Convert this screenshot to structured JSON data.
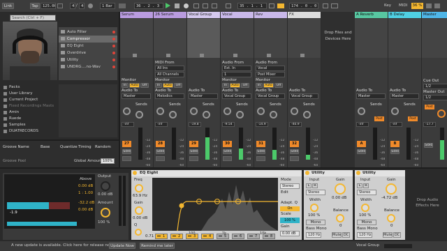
{
  "transport": {
    "link": "Link",
    "tap": "Tap",
    "tempo": "125.00",
    "sig_num": "4",
    "sig_den": "4",
    "quantize": "1 Bar",
    "position": "36 .    2 .    3",
    "loop_start": "35 .    1 .    1",
    "loop_length": "174 .    0 .    0",
    "key_label": "Key",
    "midi_label": "MIDI",
    "cpu": "36 %"
  },
  "browser": {
    "search_placeholder": "Search (Ctrl + F)",
    "categories": [
      "Packs",
      "User Library",
      "Current Project",
      "Fixed Recordings Masts",
      "Amin",
      "Ruede",
      "Samples",
      "DUATRECORDS"
    ],
    "items": [
      {
        "label": "Auto Filter",
        "selected": false
      },
      {
        "label": "Compressor",
        "selected": true
      },
      {
        "label": "EQ Eight",
        "selected": false
      },
      {
        "label": "Overdrive",
        "selected": false
      },
      {
        "label": "Utility",
        "selected": false
      },
      {
        "label": "UNDRG....no-Wav",
        "selected": false
      }
    ]
  },
  "groove": {
    "headers": [
      "Groove Name",
      "Base",
      "Quantize",
      "Timing",
      "Random"
    ],
    "pool_label": "Groove Pool",
    "global_amount_label": "Global Amount",
    "global_amount": "100%"
  },
  "tracks": [
    {
      "name": "Serum",
      "color": "#b99be0",
      "number": "27",
      "vol": "-inf",
      "input_type": "",
      "input_channel": "",
      "monitor": "Off",
      "out": "Master",
      "highlighted": false
    },
    {
      "name": "26 Serum",
      "color": "#b99be0",
      "number": "28",
      "vol": "-inf",
      "input_type": "All Ins",
      "input_channel": "All Channels",
      "monitor": "Off",
      "out": "Melodics",
      "highlighted": false
    },
    {
      "name": "Vocal Group",
      "color": "#d4c8ee",
      "number": "29",
      "vol": "-19.8",
      "input_type": "",
      "input_channel": "",
      "monitor": "",
      "out": "Master",
      "highlighted": true
    },
    {
      "name": "Vocal",
      "color": "#c9b8ea",
      "number": "30",
      "vol": "-9.54",
      "input_type": "Ext. In",
      "input_channel": "1",
      "monitor": "Off",
      "out": "Vocal Group",
      "highlighted": false
    },
    {
      "name": "Rev",
      "color": "#c9b8ea",
      "number": "31",
      "vol": "-14.9",
      "input_type": "Vocal",
      "input_channel": "Post Mixer",
      "monitor": "Off",
      "out": "Vocal Group",
      "highlighted": false
    },
    {
      "name": "FX",
      "color": "#dcdcdc",
      "number": "32",
      "vol": "-40.9",
      "input_type": "",
      "input_channel": "",
      "monitor": "",
      "out": "Vocal Group",
      "highlighted": false
    }
  ],
  "returns": [
    {
      "name": "A Reverb",
      "color": "#57c7a1",
      "letter": "A",
      "vol": "-inf",
      "out": "Master"
    },
    {
      "name": "B Delay",
      "color": "#4fd0e2",
      "letter": "B",
      "vol": "-inf",
      "out": "Master"
    },
    {
      "name": "Master",
      "color": "#4fb6e8",
      "vol": "-17.7",
      "cue_out": "1/2",
      "master_out": "1/2"
    }
  ],
  "mixer_labels": {
    "midi_from": "MIDI From",
    "audio_from": "Audio From",
    "monitor": "Monitor",
    "monitor_in": "In",
    "monitor_auto": "Auto",
    "audio_to": "Audio To",
    "sends": "Sends",
    "cue_out": "Cue Out",
    "master_out": "Master Out",
    "post": "Post",
    "solo": "Solo",
    "drop_files": "Drop Files and Devices Here",
    "scale": [
      "-12",
      "-24",
      "-36",
      "-48",
      "-60"
    ]
  },
  "devices": {
    "compressor": {
      "above": "Above",
      "gr_value": "0.00 dB",
      "ratio": "1 : 1.00",
      "thresh_val": "-32.2 dB",
      "gain_val": "0.00 dB",
      "neg_label": "-1.9",
      "output": "Output",
      "output_val": "0.00 dB",
      "amount": "Amount",
      "amount_val": "100 %"
    },
    "eq": {
      "title": "EQ Eight",
      "freq": "Freq",
      "freq_val": "63.9 Hz",
      "gain": "Gain",
      "gain_val": "0.00 dB",
      "q": "Q",
      "q_val": "0.71",
      "x_labels": [
        "100",
        "1k",
        "10k"
      ],
      "mode": "Mode",
      "mode_val": "Stereo",
      "edit": "Edit",
      "adapt_q": "Adapt. Q",
      "adapt_on": "On",
      "scale": "Scale",
      "scale_val": "100 %",
      "gain_out": "Gain",
      "gain_out_val": "0.00 dB",
      "bands": [
        "1",
        "2",
        "3",
        "4",
        "5",
        "6",
        "7",
        "8"
      ]
    },
    "utility1": {
      "title": "Utility",
      "input": "Input",
      "gain": "Gain",
      "gain_val": "0.00 dB",
      "mode_val": "Stereo",
      "width": "Width",
      "width_val": "100 %",
      "mono": "Mono",
      "balance": "Balance",
      "balance_val": "0",
      "bass_mono": "Bass Mono",
      "bass_freq": "120 Hz",
      "mute": "Mute",
      "dc": "DC"
    },
    "utility2": {
      "title": "Utility",
      "input": "Input",
      "gain": "Gain",
      "gain_val": "-4.72 dB",
      "mode_val": "Stereo",
      "width": "Width",
      "width_val": "100 %",
      "mono": "Mono",
      "balance": "Balance",
      "balance_val": "0",
      "bass_mono": "Bass Mono",
      "bass_freq": "120 Hz",
      "mute": "Mute",
      "dc": "DC"
    },
    "drop_audio_effects": "Drop Audio Effects Here"
  },
  "status": {
    "message": "A new update is available. Click here for release notes.",
    "update_now": "Update Now",
    "remind": "Remind me later",
    "vocal_group": "Vocal Group"
  },
  "colors": {
    "accent": "#f4b730",
    "meter": "#4cc96a",
    "orange": "#f08a2a"
  }
}
